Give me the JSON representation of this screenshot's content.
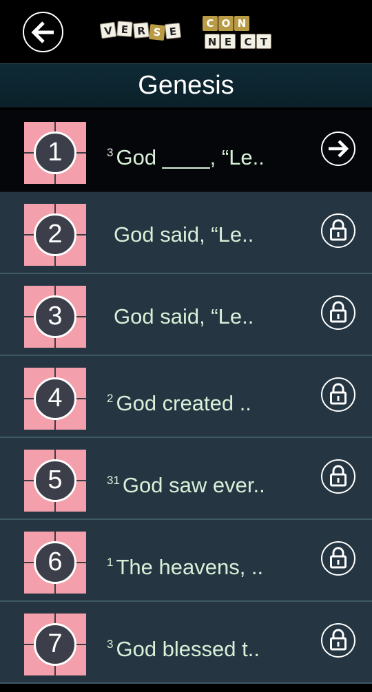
{
  "header": {
    "back_icon": "arrow-left-icon",
    "logo": {
      "top": [
        "V",
        "E",
        "R",
        "S",
        "E"
      ],
      "mid": [
        "C",
        "O",
        "N"
      ],
      "bottom": [
        "N",
        "E",
        "C",
        "T"
      ],
      "text": "VERSECONNECT"
    }
  },
  "title": "Genesis",
  "colors": {
    "thumb": "#f3a0ac",
    "row_bg": "#253642",
    "active_bg": "#040609",
    "verse_text": "#d8f0d8",
    "logo_gold": "#b99a45"
  },
  "levels": [
    {
      "number": "1",
      "sup": "3",
      "text": "God ____, “Le..",
      "status": "unlocked",
      "icon": "arrow-right-icon"
    },
    {
      "number": "2",
      "sup": "",
      "text": "God said, “Le..",
      "status": "locked",
      "icon": "lock-icon"
    },
    {
      "number": "3",
      "sup": "",
      "text": "God said, “Le..",
      "status": "locked",
      "icon": "lock-icon"
    },
    {
      "number": "4",
      "sup": "2",
      "text": "God created ..",
      "status": "locked",
      "icon": "lock-icon"
    },
    {
      "number": "5",
      "sup": "31",
      "text": "God saw ever..",
      "status": "locked",
      "icon": "lock-icon"
    },
    {
      "number": "6",
      "sup": "1",
      "text": "The heavens, ..",
      "status": "locked",
      "icon": "lock-icon"
    },
    {
      "number": "7",
      "sup": "3",
      "text": "God blessed t..",
      "status": "locked",
      "icon": "lock-icon"
    }
  ]
}
